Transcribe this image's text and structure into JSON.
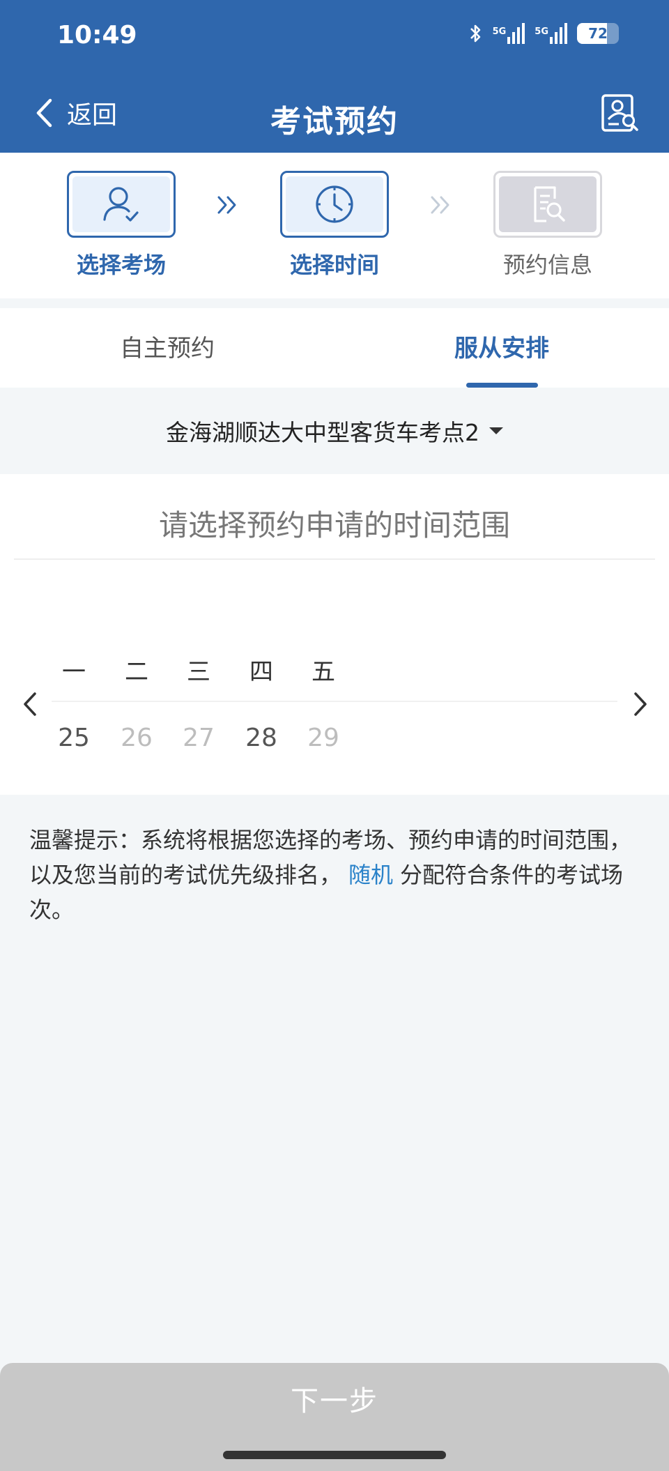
{
  "status_bar": {
    "time": "10:49",
    "signal1_label": "5G",
    "signal2_label": "5G",
    "battery": "72",
    "battery_level_percent": 72
  },
  "header": {
    "back_label": "返回",
    "title": "考试预约",
    "icons": {
      "back": "chevron-left-icon",
      "right": "profile-search-icon"
    }
  },
  "steps": [
    {
      "label": "选择考场",
      "icon": "user-check-icon",
      "state": "done"
    },
    {
      "label": "选择时间",
      "icon": "clock-icon",
      "state": "current"
    },
    {
      "label": "预约信息",
      "icon": "document-search-icon",
      "state": "pending"
    }
  ],
  "tabs": [
    {
      "label": "自主预约",
      "active": false
    },
    {
      "label": "服从安排",
      "active": true
    }
  ],
  "location": {
    "selected": "金海湖顺达大中型客货车考点2"
  },
  "date_picker": {
    "hint": "请选择预约申请的时间范围",
    "weekdays": [
      "一",
      "二",
      "三",
      "四",
      "五"
    ],
    "days": [
      {
        "num": "25",
        "enabled": true
      },
      {
        "num": "26",
        "enabled": false
      },
      {
        "num": "27",
        "enabled": false
      },
      {
        "num": "28",
        "enabled": true
      },
      {
        "num": "29",
        "enabled": false
      }
    ]
  },
  "tip": {
    "part1": "温馨提示：系统将根据您选择的考场、预约申请的时间范围，以及您当前的考试优先级排名，",
    "highlight": "随机",
    "part2": "分配符合条件的考试场次。"
  },
  "footer": {
    "next_label": "下一步"
  },
  "colors": {
    "primary": "#2f67ad",
    "link": "#2a82c9",
    "page_bg": "#f3f6f8",
    "disabled_button": "#c8c8c8"
  }
}
